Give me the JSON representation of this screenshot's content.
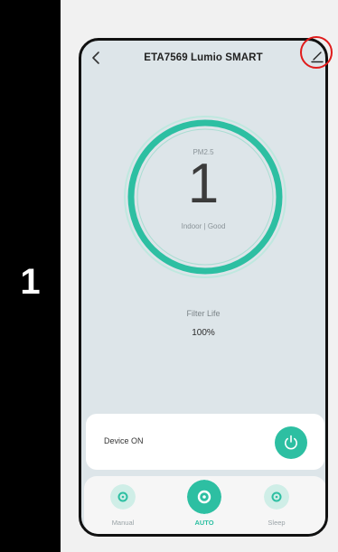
{
  "step": {
    "number": "1"
  },
  "header": {
    "title": "ETA7569 Lumio SMART",
    "back_icon": "chevron-left-icon",
    "edit_icon": "pencil-icon"
  },
  "gauge": {
    "label": "PM2.5",
    "value": "1",
    "status": "Indoor | Good"
  },
  "filter": {
    "label": "Filter Life",
    "value": "100%"
  },
  "device": {
    "label": "Device ON"
  },
  "modes": [
    {
      "label": "Manual",
      "icon": "fan-icon",
      "active": false
    },
    {
      "label": "AUTO",
      "icon": "fan-icon",
      "active": true
    },
    {
      "label": "Sleep",
      "icon": "fan-icon",
      "active": false
    }
  ],
  "colors": {
    "accent": "#2dbfa2",
    "highlight": "#e01b1b",
    "screen_bg": "#dde5e9"
  }
}
